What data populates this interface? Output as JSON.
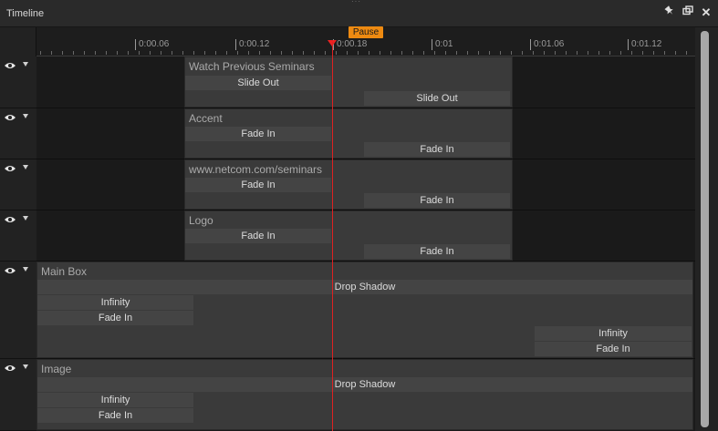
{
  "panel": {
    "title": "Timeline"
  },
  "titlebar_icons": [
    "pin-icon",
    "restore-icon",
    "close-icon"
  ],
  "close_glyph": "✕",
  "ruler": {
    "labels": [
      "0:00.06",
      "0:00.12",
      "0:00.18",
      "0:01",
      "0:01.06",
      "0:01.12"
    ]
  },
  "playhead": {
    "label": "Pause",
    "color": "#ee8a11",
    "line_color": "#dd2222"
  },
  "tracks": [
    {
      "name": "Watch Previous Seminars",
      "effects": [
        "Slide Out",
        "Slide Out"
      ]
    },
    {
      "name": "Accent",
      "effects": [
        "Fade In",
        "Fade In"
      ]
    },
    {
      "name": "www.netcom.com/seminars",
      "effects": [
        "Fade In",
        "Fade In"
      ]
    },
    {
      "name": "Logo",
      "effects": [
        "Fade In",
        "Fade In"
      ]
    },
    {
      "name": "Main Box",
      "effects": [
        "Drop Shadow",
        "Infinity",
        "Fade In",
        "Infinity",
        "Fade In"
      ]
    },
    {
      "name": "Image",
      "effects": [
        "Drop Shadow",
        "Infinity",
        "Fade In"
      ]
    }
  ]
}
